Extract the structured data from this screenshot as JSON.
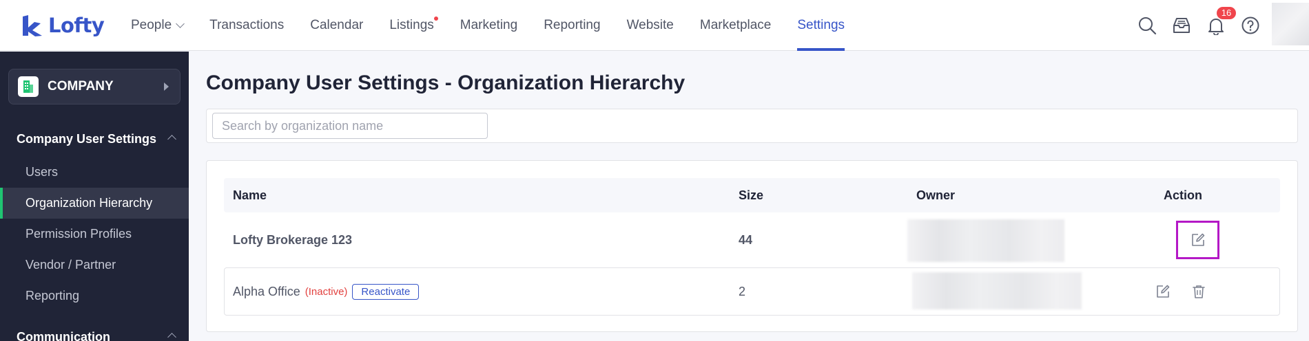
{
  "brand": {
    "name": "Lofty",
    "color": "#3755c8"
  },
  "nav": {
    "items": [
      {
        "label": "People",
        "has_dropdown": true
      },
      {
        "label": "Transactions"
      },
      {
        "label": "Calendar"
      },
      {
        "label": "Listings",
        "has_dot": true
      },
      {
        "label": "Marketing"
      },
      {
        "label": "Reporting"
      },
      {
        "label": "Website"
      },
      {
        "label": "Marketplace"
      },
      {
        "label": "Settings",
        "active": true
      }
    ],
    "icons": [
      "search-icon",
      "inbox-icon",
      "bell-icon",
      "help-icon"
    ],
    "notification_count": "16"
  },
  "sidebar": {
    "company_label": "COMPANY",
    "sections": [
      {
        "title": "Company User Settings",
        "items": [
          {
            "label": "Users"
          },
          {
            "label": "Organization Hierarchy",
            "active": true
          },
          {
            "label": "Permission Profiles"
          },
          {
            "label": "Vendor / Partner"
          },
          {
            "label": "Reporting"
          }
        ]
      },
      {
        "title": "Communication"
      }
    ]
  },
  "main": {
    "title": "Company User Settings - Organization Hierarchy",
    "search_placeholder": "Search by organization name",
    "table": {
      "headers": {
        "name": "Name",
        "size": "Size",
        "owner": "Owner",
        "action": "Action"
      },
      "rows": [
        {
          "name": "Lofty Brokerage 123",
          "size": "44",
          "owner": "",
          "actions": [
            "edit-icon"
          ]
        },
        {
          "name": "Alpha Office",
          "status": "(Inactive)",
          "reactivate_label": "Reactivate",
          "size": "2",
          "owner": "",
          "actions": [
            "edit-icon",
            "trash-icon"
          ]
        }
      ]
    }
  },
  "colors": {
    "accent": "#3755c8",
    "sidebar_bg": "#202437",
    "active_marker": "#20c472",
    "inactive": "#e2413f",
    "badge": "#f0454c",
    "highlight": "#b418c6"
  }
}
